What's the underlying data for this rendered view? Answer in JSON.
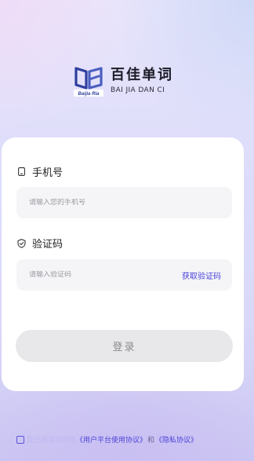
{
  "brand": {
    "name_cn": "百佳单词",
    "name_en": "BAI JIA DAN CI",
    "logo_caption": "Baijia Ria",
    "logo_icon": "open-book-icon"
  },
  "phone": {
    "label": "手机号",
    "placeholder": "请输入您的手机号",
    "icon": "phone-icon"
  },
  "code": {
    "label": "验证码",
    "placeholder": "请输入验证码",
    "get_code_label": "获取验证码",
    "icon": "shield-check-icon"
  },
  "login": {
    "label": "登录"
  },
  "agreement": {
    "text": "我已阅读并同意",
    "user_link": "《用户平台使用协议》",
    "and": "和",
    "privacy_link": "《隐私协议》",
    "checked": false
  },
  "colors": {
    "accent": "#4a43d9",
    "login_disabled_bg": "#e8e8ea",
    "logo_blue": "#2f3f9e"
  }
}
